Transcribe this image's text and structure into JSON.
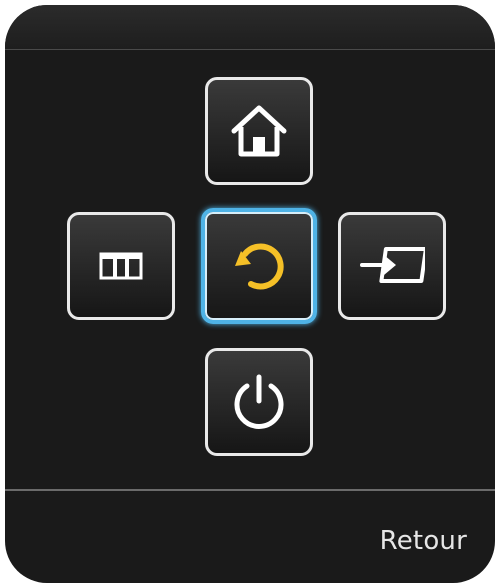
{
  "controller": {
    "buttons": [
      {
        "id": "home",
        "icon": "home-icon",
        "selected": false
      },
      {
        "id": "menu",
        "icon": "menu-icon",
        "selected": false
      },
      {
        "id": "return",
        "icon": "return-icon",
        "selected": true
      },
      {
        "id": "source",
        "icon": "input-source-icon",
        "selected": false
      },
      {
        "id": "power",
        "icon": "power-icon",
        "selected": false
      }
    ],
    "selected_label": "Retour",
    "colors": {
      "panel": "#1a1a1a",
      "button_border": "#e9e9e9",
      "selection": "#4fb3e6",
      "return_icon": "#f5c027",
      "icon": "#ffffff"
    }
  }
}
